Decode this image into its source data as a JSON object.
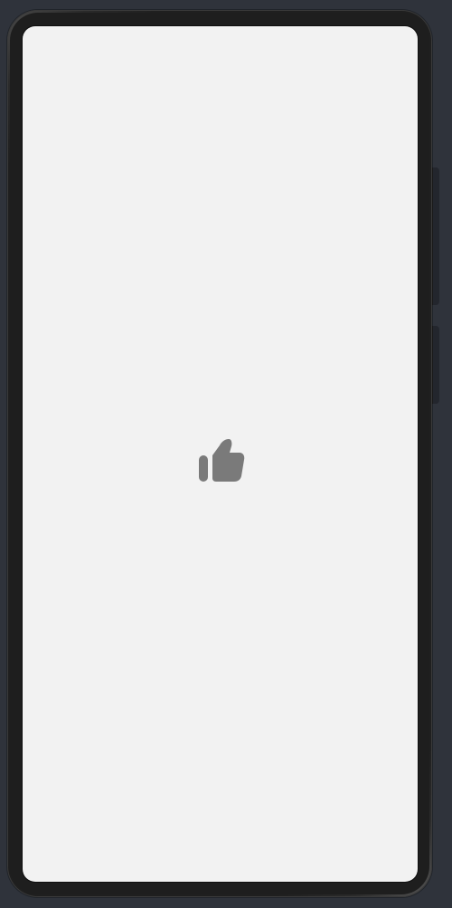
{
  "app": {
    "icons": {
      "center": "thumbs-up-icon"
    },
    "colors": {
      "screen_background": "#f2f2f2",
      "icon_color": "#7a7a7a",
      "frame": "#1e1e1e",
      "background": "#2f333b"
    }
  }
}
